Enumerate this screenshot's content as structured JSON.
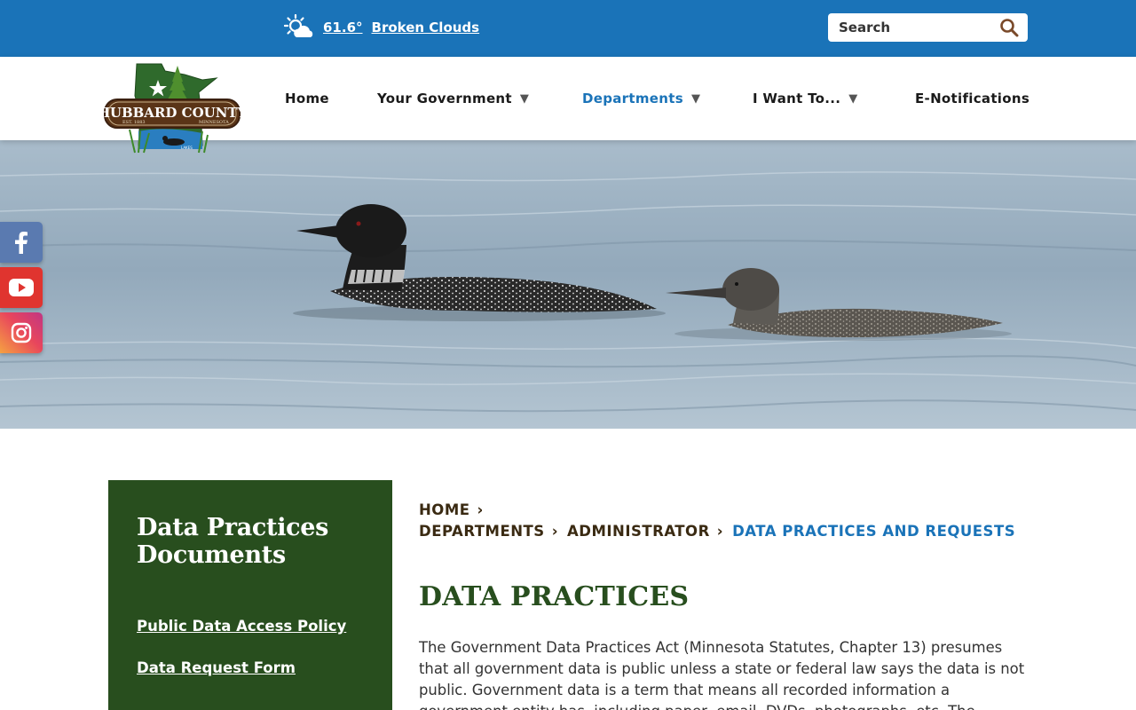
{
  "topbar": {
    "weather_temp": "61.6°",
    "weather_condition": "Broken Clouds",
    "weather_icon": "sun-cloud-icon",
    "search_placeholder": "Search",
    "search_icon": "search-icon"
  },
  "logo": {
    "text": "HUBBARD COUNTY",
    "est": "EST. 1883",
    "state": "MINNESOTA",
    "lake": "LAKES"
  },
  "nav": {
    "items": [
      {
        "label": "Home",
        "has_dropdown": false
      },
      {
        "label": "Your Government",
        "has_dropdown": true
      },
      {
        "label": "Departments",
        "has_dropdown": true,
        "active": true
      },
      {
        "label": "I Want To...",
        "has_dropdown": true
      },
      {
        "label": "E-Notifications",
        "has_dropdown": false
      }
    ],
    "caret": "▼"
  },
  "social": [
    {
      "name": "facebook",
      "icon": "facebook-icon"
    },
    {
      "name": "youtube",
      "icon": "youtube-icon"
    },
    {
      "name": "instagram",
      "icon": "instagram-icon"
    }
  ],
  "sidebar": {
    "title": "Data Practices Documents",
    "links": [
      "Public Data Access Policy",
      "Data Request Form"
    ]
  },
  "breadcrumb": {
    "items": [
      "HOME",
      "DEPARTMENTS",
      "ADMINISTRATOR"
    ],
    "current": "DATA PRACTICES AND REQUESTS"
  },
  "main": {
    "title": "DATA PRACTICES",
    "paragraph": "The Government Data Practices Act (Minnesota Statutes, Chapter 13) presumes that all government data is public unless a state or federal law says the data is not public. Government data is a term that means all recorded information a government entity has, including paper, email, DVDs, photographs, etc. The"
  },
  "colors": {
    "topbar": "#1a73b8",
    "sidebar": "#284e1e",
    "title": "#284e1e",
    "breadcrumb_current": "#1a73b8"
  }
}
